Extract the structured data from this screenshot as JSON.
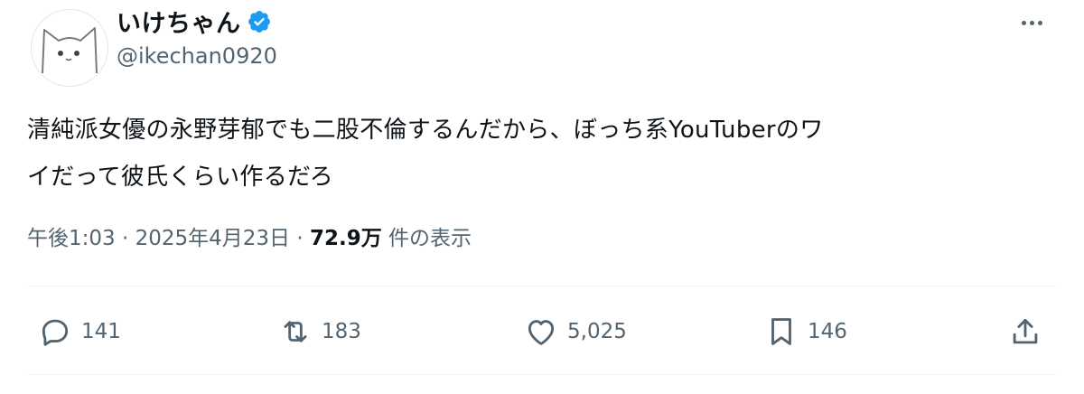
{
  "author": {
    "display_name": "いけちゃん",
    "handle": "@ikechan0920",
    "verified": true
  },
  "tweet": {
    "text_line1": "清純派女優の永野芽郁でも二股不倫するんだから、ぼっち系YouTuberのワ",
    "text_line2": "イだって彼氏くらい作るだろ",
    "time": "午後1:03",
    "sep1": " · ",
    "date": "2025年4月23日",
    "sep2": " · ",
    "views": "72.9万",
    "views_label": " 件の表示"
  },
  "actions": {
    "replies": "141",
    "retweets": "183",
    "likes": "5,025",
    "bookmarks": "146"
  },
  "colors": {
    "verified": "#1d9bf0",
    "muted": "#536471",
    "text": "#0f1419"
  }
}
